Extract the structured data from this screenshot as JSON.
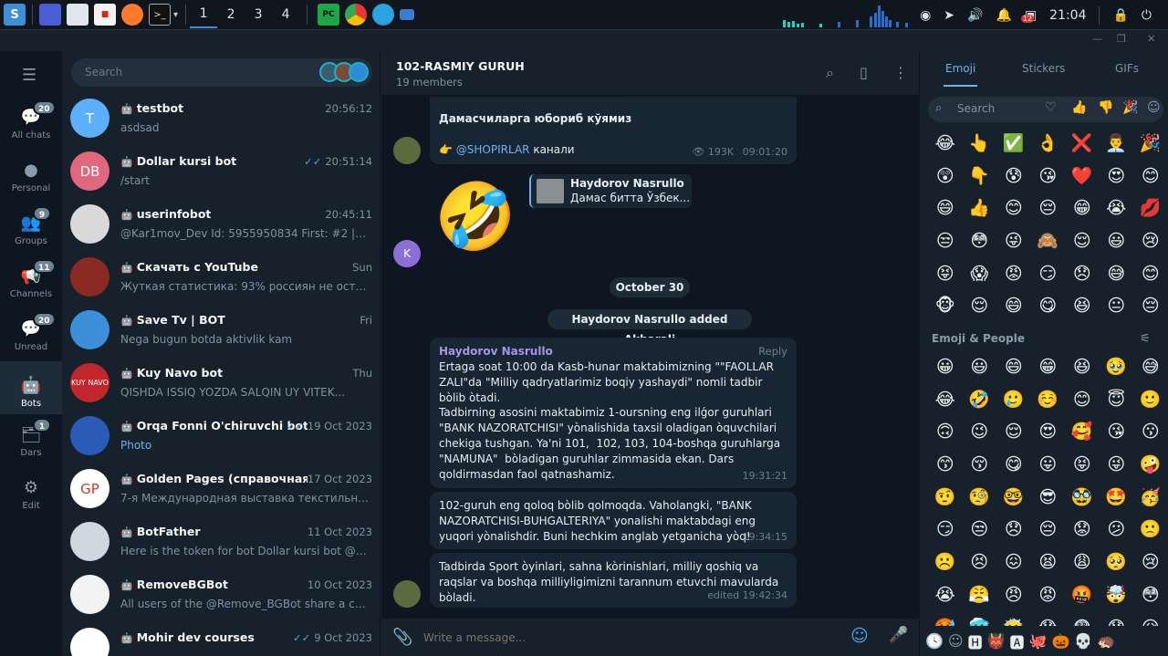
{
  "taskbar": {
    "workspaces": [
      "1",
      "2",
      "3",
      "4"
    ],
    "clock": "21:04",
    "badge": "12"
  },
  "sidebar": {
    "items": [
      {
        "label": "All chats",
        "badge": "20",
        "icon": "chats-icon"
      },
      {
        "label": "Personal",
        "badge": "",
        "icon": "person-icon"
      },
      {
        "label": "Groups",
        "badge": "9",
        "icon": "groups-icon"
      },
      {
        "label": "Channels",
        "badge": "11",
        "icon": "channels-icon"
      },
      {
        "label": "Unread",
        "badge": "20",
        "icon": "unread-icon"
      },
      {
        "label": "Bots",
        "badge": "",
        "icon": "bot-icon"
      },
      {
        "label": "Dars",
        "badge": "1",
        "icon": "folder-icon"
      },
      {
        "label": "Edit",
        "badge": "",
        "icon": "edit-icon"
      }
    ]
  },
  "search": {
    "placeholder": "Search"
  },
  "chats": [
    {
      "name": "testbot",
      "time": "20:56:12",
      "preview": "asdsad",
      "avatar": "T",
      "color": "#5caffa"
    },
    {
      "name": "Dollar kursi bot",
      "time": "20:51:14",
      "preview": "/start",
      "avatar": "DB",
      "color": "#e1677d"
    },
    {
      "name": "userinfobot",
      "time": "20:45:11",
      "preview": "@Kar1mov_Dev Id: 5955950834 First: #2 |Amir...",
      "avatar": "",
      "color": "#d9d9d9"
    },
    {
      "name": "Скачать с YouTube",
      "time": "Sun",
      "preview": "Жуткая статистика: 93% россиян не остав...",
      "avatar": "",
      "color": "#8a2a22"
    },
    {
      "name": "Save Tv | BOT",
      "time": "Fri",
      "preview": "Nega bugun botda aktivlik kam",
      "avatar": "",
      "color": "#3c8fd8"
    },
    {
      "name": "Kuy Navo bot",
      "time": "Thu",
      "preview": "QISHDA ISSIQ YOZDA SALQIN UY  VITEK...",
      "avatar": "KUY NAVO",
      "color": "#c0262c"
    },
    {
      "name": "Orqa Fonni O'chiruvchi bot",
      "time": "19 Oct 2023",
      "preview": "Photo",
      "avatar": "",
      "color": "#2b5bb8"
    },
    {
      "name": "Golden Pages (справочная)",
      "time": "17 Oct 2023",
      "preview": "7-я Международная выставка текстильн...",
      "avatar": "GP",
      "color": "#ffffff"
    },
    {
      "name": "BotFather",
      "time": "11 Oct 2023",
      "preview": "Here is the token for bot Dollar kursi bot @Doll...",
      "avatar": "",
      "color": "#cfd8e0"
    },
    {
      "name": "RemoveBGBot",
      "time": "10 Oct 2023",
      "preview": "All users of the @Remove_BGBot share a com...",
      "avatar": "",
      "color": "#f3f3f3"
    },
    {
      "name": "Mohir dev courses",
      "time": "9 Oct 2023",
      "preview": "",
      "avatar": "",
      "color": "#ffffff"
    }
  ],
  "header": {
    "title": "102-RASMIY GURUH",
    "subtitle": "19 members"
  },
  "messages": {
    "m1_text": "Дамасчиларга юбориб кўямиз",
    "m1_link": "@SHOPIRLAR",
    "m1_suffix": " канали",
    "m1_views": "193K",
    "m1_time": "09:01:20",
    "reply_name": "Haydorov Nasrullo",
    "reply_text": "Дамас битта Ўзбек...",
    "k_avatar": "K",
    "date": "October 30",
    "service": "Haydorov Nasrullo added Akbarali",
    "m2_author": "Haydorov Nasrullo",
    "m2_reply": "Reply",
    "m2_text": "Ertaga soat 10:00 da Kasb-hunar maktabimizning \"\"FAOLLAR ZALI\"da \"Milliy qadryatlarimiz boqiy yashaydi\" nomli tadbir bòlib òtadi.\nTadbirning asosini maktabimiz 1-oursning eng ilǵor guruhlari \"BANK NAZORATCHISI\" yònalishida taxsil oladigan òquvchilari chekiga tushgan. Ya'ni 101,  102, 103, 104-boshqa guruhlarga \"NAMUNA\"  bòladigan guruhlar zimmasida ekan. Dars qoldirmasdan faol qatnashamiz.",
    "m2_time": "19:31:21",
    "m3_text": "102-guruh eng qoloq bòlib qolmoqda. Vaholangki, \"BANK NAZORATCHISI-BUHGALTERIYA\" yonalishi maktabdagi eng yuqori yònalishdir.  Buni hechkim anglab yetganicha yòq!",
    "m3_time": "19:34:15",
    "m4_text": "Tadbirda Sport òyinlari, sahna kòrinishlari, milliy qoshiq va raqslar va boshqa milliyligimizni tarannum etuvchi mavularda bòladi.",
    "m4_time": "edited 19:42:34"
  },
  "composer": {
    "placeholder": "Write a message..."
  },
  "emoji_panel": {
    "tabs": [
      "Emoji",
      "Stickers",
      "GIFs"
    ],
    "search_placeholder": "Search",
    "section": "Emoji & People",
    "recent": [
      "😂",
      "👆",
      "✅",
      "👌",
      "❌",
      "👨‍💼",
      "🎉",
      "😲",
      "👇",
      "😰",
      "😘",
      "❤️",
      "😍",
      "😊",
      "😄",
      "👍",
      "😊",
      "😔",
      "😁",
      "😭",
      "💋",
      "😒",
      "😳",
      "😜",
      "🙈",
      "😌",
      "😃",
      "😢",
      "😝",
      "😱",
      "😡",
      "😏",
      "😞",
      "😅",
      "😊",
      "🐵",
      "😌",
      "😄",
      "😋",
      "😆",
      "😐",
      "😔"
    ],
    "people": [
      "😀",
      "😃",
      "😄",
      "😁",
      "😆",
      "🥹",
      "😅",
      "😂",
      "🤣",
      "🥲",
      "☺️",
      "😊",
      "😇",
      "🙂",
      "🙃",
      "😉",
      "😌",
      "😍",
      "🥰",
      "😘",
      "😗",
      "😙",
      "😚",
      "😋",
      "😛",
      "😝",
      "😜",
      "🤪",
      "🤨",
      "🧐",
      "🤓",
      "😎",
      "🥸",
      "🤩",
      "🥳",
      "😏",
      "😒",
      "😞",
      "😔",
      "😟",
      "😕",
      "🙁",
      "☹️",
      "😣",
      "😖",
      "😫",
      "😩",
      "🥺",
      "😢",
      "😭",
      "😤",
      "😠",
      "😡",
      "🤬",
      "🤯",
      "😳",
      "🥵",
      "🥶",
      "😶‍🌫️",
      "😱",
      "😨",
      "😰",
      "😥",
      "😓"
    ]
  }
}
